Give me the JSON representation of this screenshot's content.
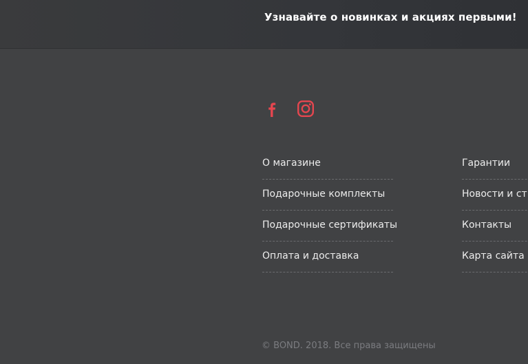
{
  "subscribe_bar": {
    "text": "Узнавайте о новинках и акциях первыми!"
  },
  "socials": {
    "accent_color": "#e5464f",
    "items": [
      {
        "icon": "facebook-icon"
      },
      {
        "icon": "instagram-icon"
      }
    ]
  },
  "footer_nav": {
    "column_1": [
      {
        "label": "О магазине"
      },
      {
        "label": "Подарочные комплекты"
      },
      {
        "label": "Подарочные сертификаты"
      },
      {
        "label": "Оплата и доставка"
      }
    ],
    "column_2": [
      {
        "label": "Гарантии"
      },
      {
        "label": "Новости и ст"
      },
      {
        "label": "Контакты"
      },
      {
        "label": "Карта сайта"
      }
    ]
  },
  "copyright": "© BOND. 2018. Все права защищены"
}
